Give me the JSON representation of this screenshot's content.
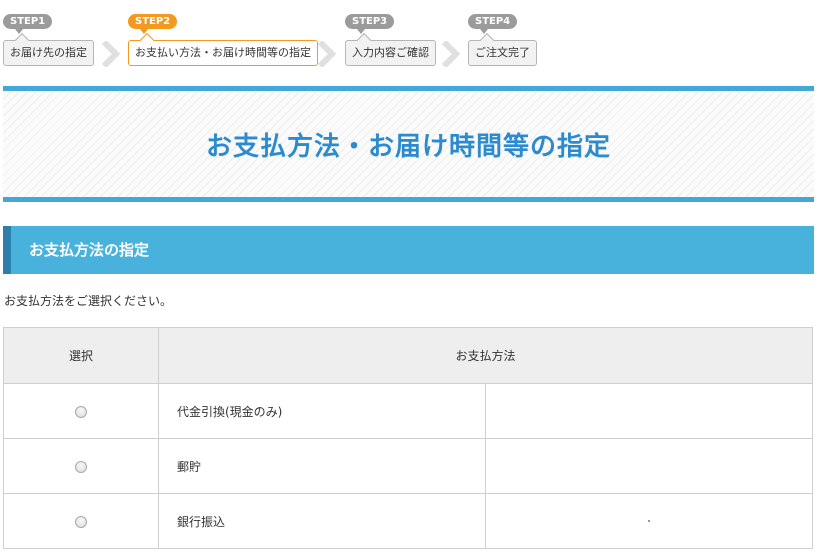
{
  "steps": [
    {
      "badge": "STEP1",
      "label": "お届け先の指定",
      "active": false
    },
    {
      "badge": "STEP2",
      "label": "お支払い方法・お届け時間等の指定",
      "active": true
    },
    {
      "badge": "STEP3",
      "label": "入力内容ご確認",
      "active": false
    },
    {
      "badge": "STEP4",
      "label": "ご注文完了",
      "active": false
    }
  ],
  "page_title": "お支払方法・お届け時間等の指定",
  "section": {
    "title": "お支払方法の指定",
    "description": "お支払方法をご選択ください。"
  },
  "table": {
    "headers": {
      "select": "選択",
      "method": "お支払方法"
    },
    "rows": [
      {
        "method": "代金引換(現金のみ)",
        "selected": false
      },
      {
        "method": "郵貯",
        "selected": false
      },
      {
        "method": "銀行振込",
        "selected": false
      }
    ]
  },
  "colors": {
    "accent": "#45a6d8",
    "section_bg": "#48b2dc",
    "title": "#2c8bcf",
    "active_step": "#f39a1e",
    "inactive_step": "#9b9b9b"
  }
}
